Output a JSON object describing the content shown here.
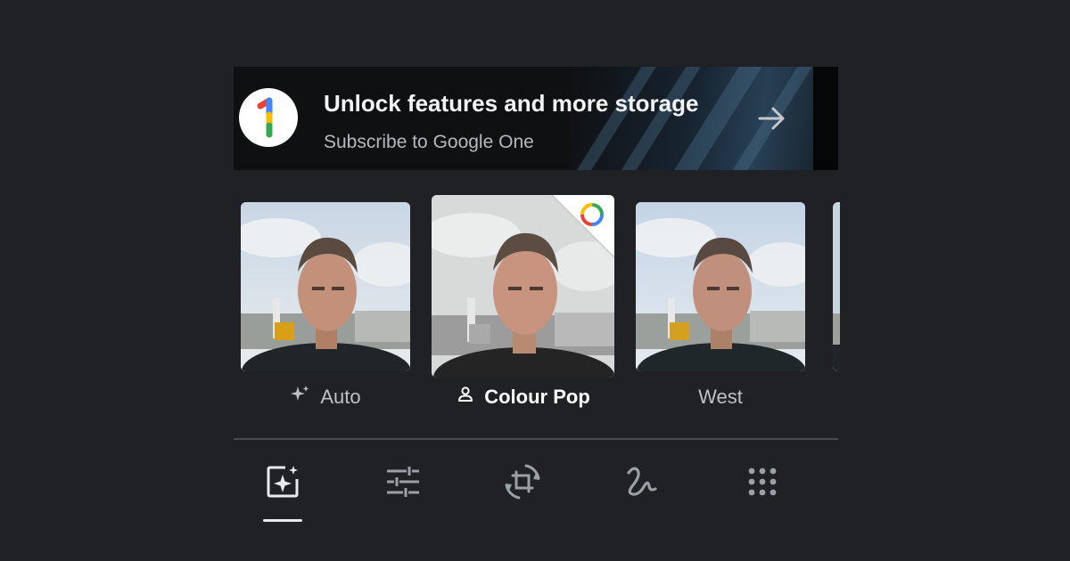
{
  "banner": {
    "title": "Unlock features and more storage",
    "subtitle": "Subscribe to Google One",
    "logo_icon": "google-one-logo",
    "arrow_icon": "arrow-right-icon"
  },
  "filters": [
    {
      "label": "Auto",
      "icon": "sparkle-icon",
      "selected": false
    },
    {
      "label": "Colour Pop",
      "icon": "person-icon",
      "selected": true,
      "badge_icon": "google-one-ring-icon"
    },
    {
      "label": "West",
      "icon": "",
      "selected": false
    }
  ],
  "toolbar": {
    "tabs": [
      {
        "name": "suggestions",
        "icon": "magic-suggest-icon",
        "selected": true
      },
      {
        "name": "adjust",
        "icon": "sliders-icon",
        "selected": false
      },
      {
        "name": "crop",
        "icon": "crop-rotate-icon",
        "selected": false
      },
      {
        "name": "markup",
        "icon": "markup-squiggle-icon",
        "selected": false
      },
      {
        "name": "more",
        "icon": "grid-dots-icon",
        "selected": false
      }
    ]
  },
  "colors": {
    "background": "#202124",
    "text_primary": "#ffffff",
    "text_secondary": "#bdc1c6",
    "google_blue": "#4285F4",
    "google_red": "#EA4335",
    "google_yellow": "#FBBC04",
    "google_green": "#34A853"
  }
}
